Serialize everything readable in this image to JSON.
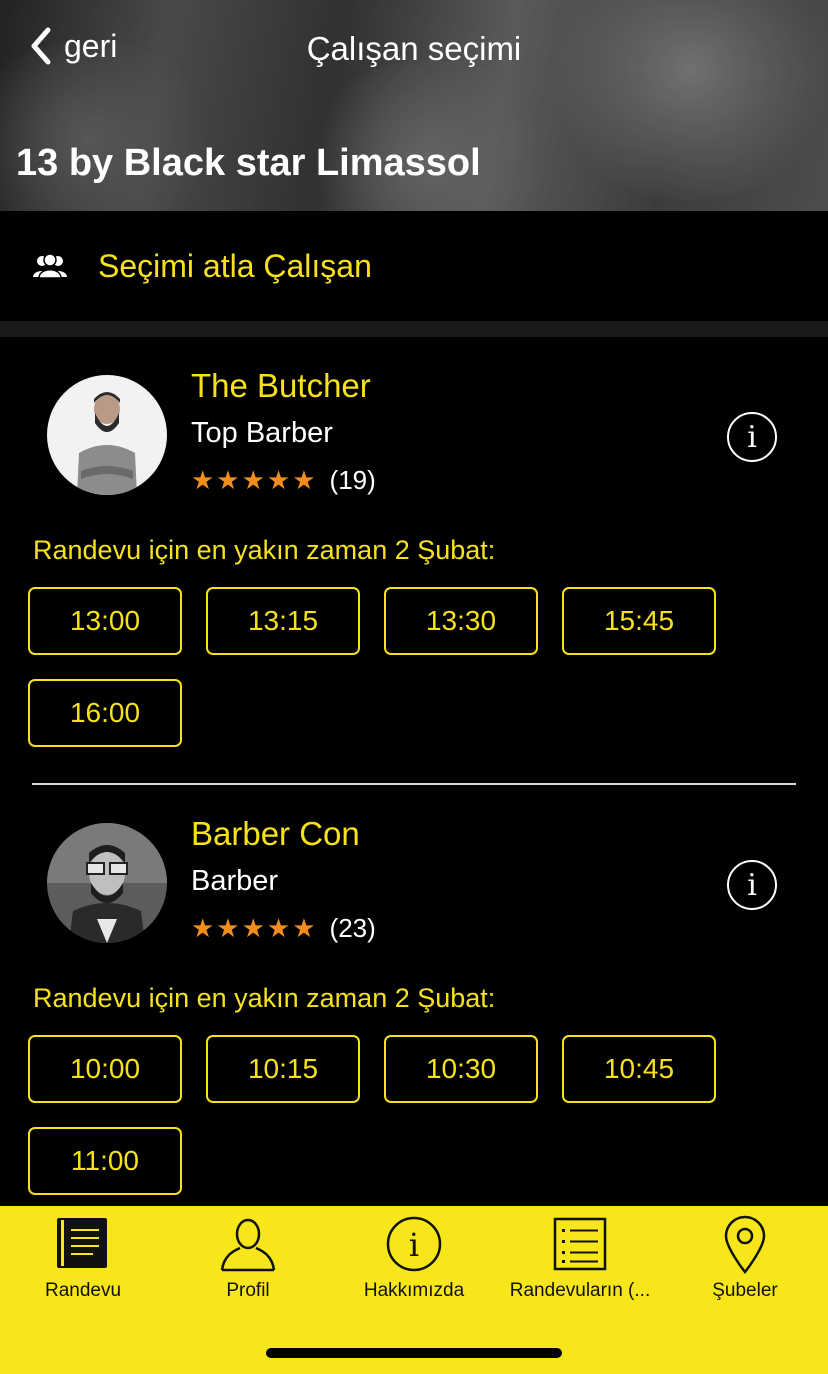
{
  "header": {
    "back_label": "geri",
    "title": "Çalışan seçimi",
    "venue": "13 by Black star Limassol"
  },
  "skip": {
    "label": "Seçimi atla Çalışan"
  },
  "employees": [
    {
      "name": "The Butcher",
      "role": "Top Barber",
      "stars": "★★★★★",
      "rating_value": 5,
      "review_count": "(19)",
      "next_label": "Randevu için en yakın zaman 2 Şubat:",
      "slots": [
        "13:00",
        "13:15",
        "13:30",
        "15:45",
        "16:00"
      ]
    },
    {
      "name": "Barber Con",
      "role": "Barber",
      "stars": "★★★★★",
      "rating_value": 5,
      "review_count": "(23)",
      "next_label": "Randevu için en yakın zaman 2 Şubat:",
      "slots": [
        "10:00",
        "10:15",
        "10:30",
        "10:45",
        "11:00"
      ]
    }
  ],
  "tabbar": {
    "items": [
      {
        "label": "Randevu",
        "icon": "book-icon"
      },
      {
        "label": "Profil",
        "icon": "person-icon"
      },
      {
        "label": "Hakkımızda",
        "icon": "info-icon"
      },
      {
        "label": "Randevuların (...",
        "icon": "list-icon"
      },
      {
        "label": "Şubeler",
        "icon": "location-pin-icon"
      }
    ]
  },
  "colors": {
    "accent": "#f6e11b",
    "star": "#f28c1c",
    "tabbar_bg": "#f6e61a",
    "background": "#000000"
  }
}
